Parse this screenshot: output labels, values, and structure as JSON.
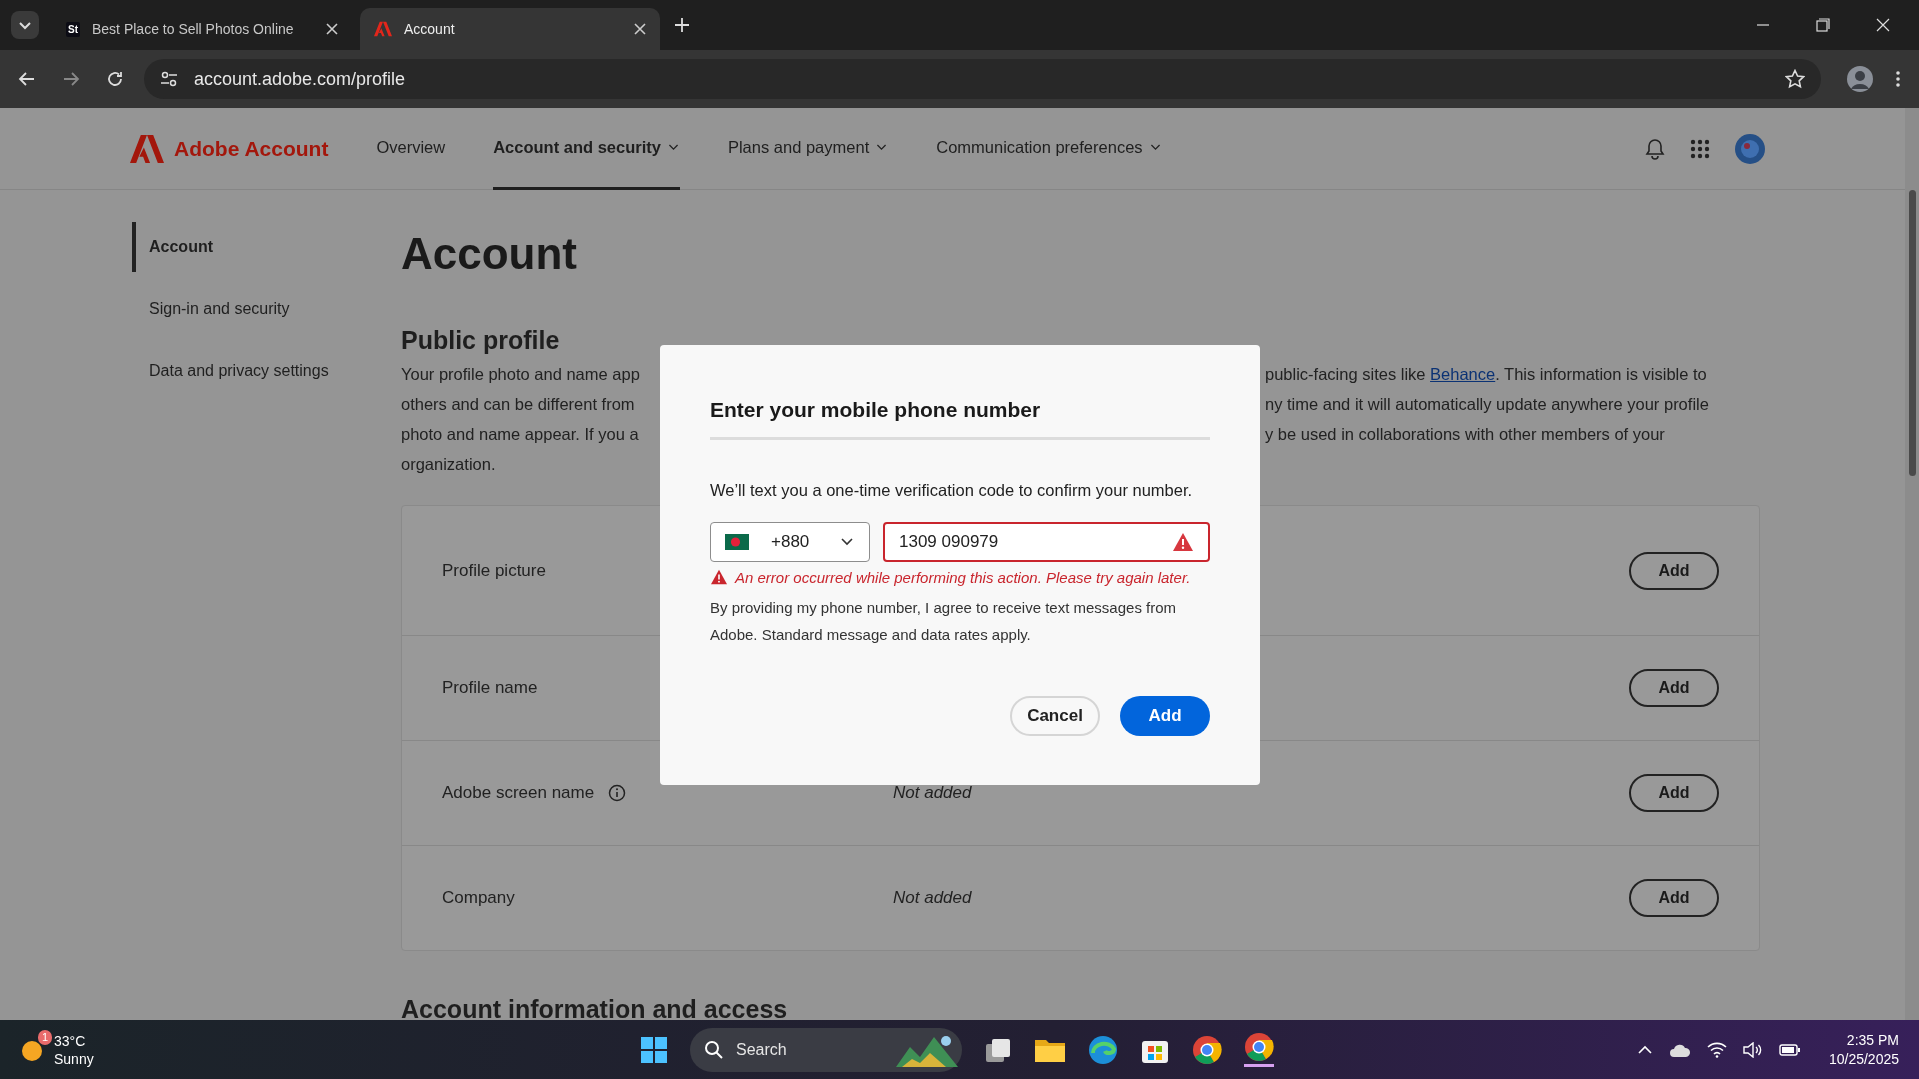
{
  "browser": {
    "tabs": [
      {
        "title": "Best Place to Sell Photos Online",
        "selected": false,
        "favicon_text": "St"
      },
      {
        "title": "Account",
        "selected": true
      }
    ],
    "url": "account.adobe.com/profile"
  },
  "header": {
    "brand": "Adobe Account",
    "nav": [
      {
        "label": "Overview",
        "selected": false,
        "has_menu": false
      },
      {
        "label": "Account and security",
        "selected": true,
        "has_menu": true
      },
      {
        "label": "Plans and payment",
        "selected": false,
        "has_menu": true
      },
      {
        "label": "Communication preferences",
        "selected": false,
        "has_menu": true
      }
    ]
  },
  "sidebar": {
    "items": [
      {
        "label": "Account",
        "selected": true
      },
      {
        "label": "Sign-in and security",
        "selected": false
      },
      {
        "label": "Data and privacy settings",
        "selected": false
      }
    ]
  },
  "page": {
    "title": "Account",
    "section_title": "Public profile",
    "description": {
      "left_lines": [
        "Your profile photo and name app",
        "others and can be different from",
        "photo and name appear. If you a",
        "organization."
      ],
      "right_lines": [
        {
          "text": "public-facing sites like ",
          "link": "Behance",
          "after": ". This information is visible to"
        },
        {
          "text": "ny time and it will automatically update anywhere your profile"
        },
        {
          "text": "y be used in collaborations with other members of your"
        }
      ]
    },
    "rows": [
      {
        "label": "Profile picture",
        "info": false,
        "button": "Add"
      },
      {
        "label": "Profile name",
        "info": false,
        "button": "Add"
      },
      {
        "label": "Adobe screen name",
        "info": true,
        "value": "Not added",
        "button": "Add"
      },
      {
        "label": "Company",
        "info": false,
        "value": "Not added",
        "button": "Add"
      }
    ],
    "next_section": "Account information and access"
  },
  "dialog": {
    "title": "Enter your mobile phone number",
    "text": "We’ll text you a one-time verification code to confirm your number.",
    "country_code": "+880",
    "phone": "1309 090979",
    "invalid": true,
    "error": "An error occurred while performing this action. Please try again later.",
    "consent": "By providing my phone number, I agree to receive text messages from Adobe. Standard message and data rates apply.",
    "cancel": "Cancel",
    "confirm": "Add"
  },
  "taskbar": {
    "temperature": "33°C",
    "condition": "Sunny",
    "weather_badge": "1",
    "search_placeholder": "Search",
    "time": "2:35 PM",
    "date": "10/25/2025"
  }
}
